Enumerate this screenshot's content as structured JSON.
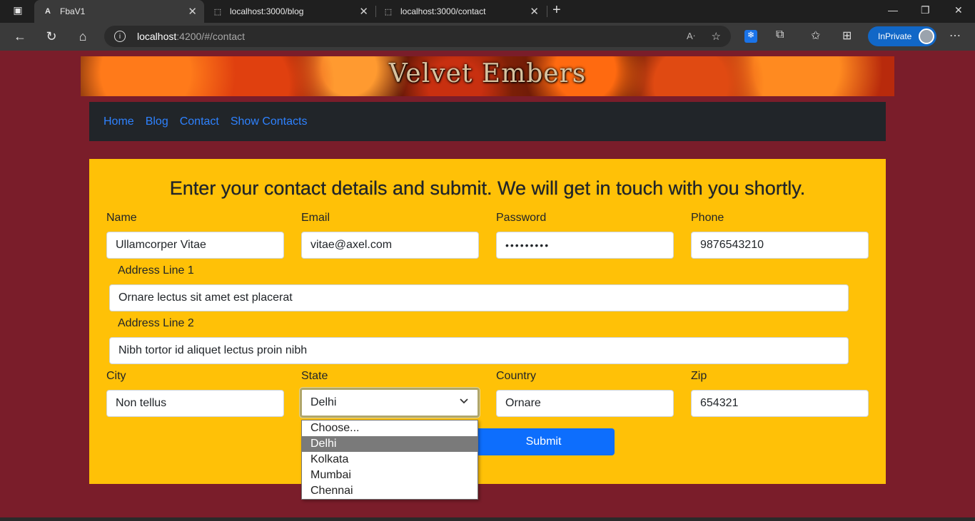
{
  "browser": {
    "tabs": [
      {
        "title": "FbaV1",
        "icon": "angular-logo-icon",
        "active": true
      },
      {
        "title": "localhost:3000/blog",
        "icon": "page-icon",
        "active": false
      },
      {
        "title": "localhost:3000/contact",
        "icon": "page-icon",
        "active": false
      }
    ],
    "url_host": "localhost",
    "url_path": ":4200/#/contact",
    "inprivate_label": "InPrivate"
  },
  "banner": {
    "title": "Velvet Embers"
  },
  "nav": {
    "items": [
      "Home",
      "Blog",
      "Contact",
      "Show Contacts"
    ]
  },
  "form": {
    "heading": "Enter your contact details and submit. We will get in touch with you shortly.",
    "name": {
      "label": "Name",
      "value": "Ullamcorper Vitae"
    },
    "email": {
      "label": "Email",
      "value": "vitae@axel.com"
    },
    "password": {
      "label": "Password",
      "value": "•••••••••"
    },
    "phone": {
      "label": "Phone",
      "value": "9876543210"
    },
    "address1": {
      "label": "Address Line 1",
      "value": "Ornare lectus sit amet est placerat"
    },
    "address2": {
      "label": "Address Line 2",
      "value": "Nibh tortor id aliquet lectus proin nibh"
    },
    "city": {
      "label": "City",
      "value": "Non tellus"
    },
    "state": {
      "label": "State",
      "value": "Delhi",
      "options": [
        "Choose...",
        "Delhi",
        "Kolkata",
        "Mumbai",
        "Chennai"
      ]
    },
    "country": {
      "label": "Country",
      "value": "Ornare"
    },
    "zip": {
      "label": "Zip",
      "value": "654321"
    },
    "submit_label": "Submit"
  },
  "colors": {
    "page_bg": "#7a1d2a",
    "card_bg": "#ffc107",
    "navbar_bg": "#212529",
    "link": "#2e82ff",
    "button": "#0d6efd"
  }
}
